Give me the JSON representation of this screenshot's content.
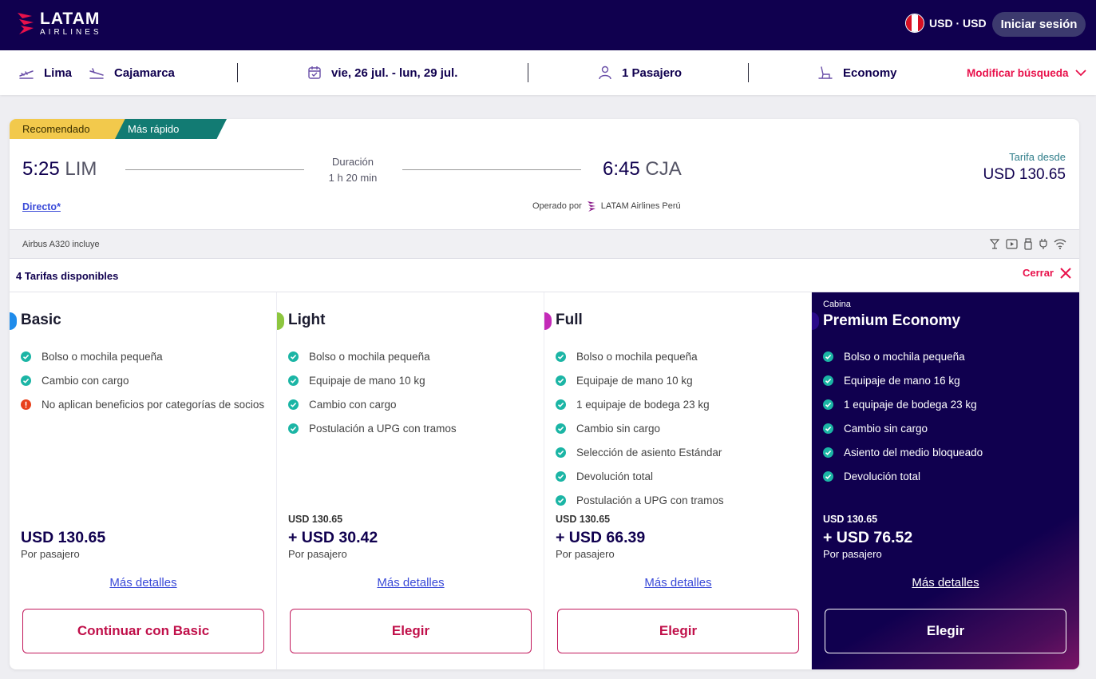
{
  "header": {
    "logo_main": "LATAM",
    "logo_sub": "AIRLINES",
    "currency": "USD · USD",
    "login_label": "Iniciar sesión",
    "flag_colors": [
      "#d91023",
      "#ffffff",
      "#d91023"
    ]
  },
  "search": {
    "origin": "Lima",
    "destination": "Cajamarca",
    "dates": "vie, 26 jul. - lun, 29 jul.",
    "passengers": "1 Pasajero",
    "cabin": "Economy",
    "modify_label": "Modificar búsqueda"
  },
  "flight": {
    "tag_recommended": "Recomendado",
    "tag_fastest": "Más rápido",
    "departure_time": "5:25",
    "departure_code": "LIM",
    "arrival_time": "6:45",
    "arrival_code": "CJA",
    "duration_label": "Duración",
    "duration": "1 h 20 min",
    "fare_from_label": "Tarifa desde",
    "fare_from_value": "USD 130.65",
    "direct_label": "Directo*",
    "operated_label": "Operado por",
    "operator": "LATAM Airlines Perú",
    "aircraft_text": "Airbus A320 incluye",
    "amenity_icons": [
      "drink-icon",
      "entertainment-icon",
      "usb-charger-icon",
      "power-plug-icon",
      "wifi-icon"
    ]
  },
  "fares_header": {
    "count_label": "4 Tarifas disponibles",
    "close_label": "Cerrar"
  },
  "fares": [
    {
      "name": "Basic",
      "accent": "#1f8ceb",
      "benefits": [
        {
          "text": "Bolso o mochila pequeña",
          "type": "check"
        },
        {
          "text": "Cambio con cargo",
          "type": "check"
        },
        {
          "text": "No aplican beneficios por categorías de socios",
          "type": "warning"
        }
      ],
      "base_price": "",
      "price": "USD 130.65",
      "per_pax": "Por pasajero",
      "details_label": "Más detalles",
      "button_label": "Continuar con Basic"
    },
    {
      "name": "Light",
      "accent": "#8dc63f",
      "benefits": [
        {
          "text": "Bolso o mochila pequeña",
          "type": "check"
        },
        {
          "text": "Equipaje de mano 10 kg",
          "type": "check"
        },
        {
          "text": "Cambio con cargo",
          "type": "check"
        },
        {
          "text": "Postulación a UPG con tramos",
          "type": "check"
        }
      ],
      "base_price": "USD  130.65",
      "price": "+ USD  30.42",
      "per_pax": "Por pasajero",
      "details_label": "Más detalles",
      "button_label": "Elegir"
    },
    {
      "name": "Full",
      "accent": "#c42ab8",
      "benefits": [
        {
          "text": "Bolso o mochila pequeña",
          "type": "check"
        },
        {
          "text": "Equipaje de mano 10 kg",
          "type": "check"
        },
        {
          "text": "1 equipaje de bodega 23 kg",
          "type": "check"
        },
        {
          "text": "Cambio sin cargo",
          "type": "check"
        },
        {
          "text": "Selección de asiento Estándar",
          "type": "check"
        },
        {
          "text": "Devolución total",
          "type": "check"
        },
        {
          "text": "Postulación a UPG con tramos",
          "type": "check"
        }
      ],
      "base_price": "USD  130.65",
      "price": "+ USD  66.39",
      "per_pax": "Por pasajero",
      "details_label": "Más detalles",
      "button_label": "Elegir"
    },
    {
      "name": "Premium Economy",
      "cabin_label": "Cabina",
      "accent": "#2a0a8a",
      "benefits": [
        {
          "text": "Bolso o mochila pequeña",
          "type": "check"
        },
        {
          "text": "Equipaje de mano 16 kg",
          "type": "check"
        },
        {
          "text": "1 equipaje de bodega 23 kg",
          "type": "check"
        },
        {
          "text": "Cambio sin cargo",
          "type": "check"
        },
        {
          "text": "Asiento del medio bloqueado",
          "type": "check"
        },
        {
          "text": "Devolución total",
          "type": "check"
        }
      ],
      "base_price": "USD  130.65",
      "price": "+ USD  76.52",
      "per_pax": "Por pasajero",
      "details_label": "Más detalles",
      "button_label": "Elegir"
    }
  ],
  "colors": {
    "navy": "#10004f",
    "brand_red": "#e8114b",
    "check_teal": "#1bb5a5",
    "warning_red": "#e8411c"
  }
}
